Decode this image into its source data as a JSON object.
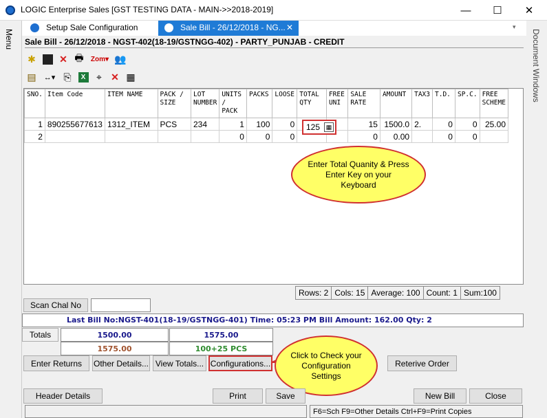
{
  "window": {
    "title": "LOGIC Enterprise Sales  [GST TESTING DATA - MAIN->>2018-2019]",
    "min_glyph": "—",
    "max_glyph": "☐",
    "close_glyph": "✕"
  },
  "side": {
    "left_label": "Menu",
    "right_label": "Document Windows"
  },
  "tabs": [
    {
      "label": "Setup Sale Configuration"
    },
    {
      "label": "Sale Bill - 26/12/2018 - NG...",
      "close": "✕"
    }
  ],
  "bill_header": "Sale Bill - 26/12/2018 - NGST-402(18-19/GSTNGG-402) - PARTY_PUNJAB - CREDIT",
  "toolbar": {
    "zoom_label": "Zom▾"
  },
  "grid": {
    "columns": [
      "SNO.",
      "Item Code",
      "ITEM NAME",
      "PACK / SIZE",
      "LOT NUMBER",
      "UNITS / PACK",
      "PACKS",
      "LOOSE",
      "TOTAL QTY",
      "FREE UNI",
      "SALE RATE",
      "AMOUNT",
      "TAX3",
      "T.D.",
      "SP.C.",
      "FREE SCHEME"
    ],
    "rows": [
      [
        "1",
        "890255677613",
        "1312_ITEM",
        "PCS",
        "234",
        "1",
        "100",
        "0",
        "125",
        "",
        "15",
        "1500.0",
        "2.",
        "0",
        "0",
        "25.00"
      ],
      [
        "2",
        "",
        "",
        "",
        "",
        "0",
        "0",
        "0",
        "",
        "",
        "0",
        "0.00",
        "",
        "0",
        "0",
        ""
      ]
    ]
  },
  "status": {
    "rows": "Rows: 2",
    "cols": "Cols: 15",
    "avg": "Average: 100",
    "count": "Count: 1",
    "sum": "Sum:100"
  },
  "scan_label": "Scan Chal No",
  "scan_value": "",
  "last_bill": "Last Bill No:NGST-401(18-19/GSTNGG-401)  Time: 05:23 PM   Bill Amount: 162.00  Qty: 2",
  "totals": {
    "label": "Totals",
    "v1": "1500.00",
    "v2": "1575.00",
    "v3": "1575.00",
    "v4": "100+25 PCS"
  },
  "buttons": {
    "enter_returns": "Enter Returns",
    "other_details": "Other Details...",
    "view_totals": "View Totals...",
    "configurations": "Configurations...",
    "retrieve_order": "Reterive Order",
    "header_details": "Header Details",
    "print": "Print",
    "save": "Save",
    "new_bill": "New Bill",
    "close": "Close"
  },
  "callouts": {
    "qty": "Enter Total Quanity & Press Enter Key on your Keyboard",
    "config": "Click to Check your Configuration Settings"
  },
  "hotkeys": "F6=Sch  F9=Other Details  Ctrl+F9=Print Copies",
  "colors": {
    "tab_active": "#1f7bd6",
    "bill_blue": "#1a1a8c",
    "tot_brown": "#a0522d",
    "tot_green": "#2e8b2e",
    "callout_fill": "#ffff66",
    "highlight_red": "#d03030"
  }
}
